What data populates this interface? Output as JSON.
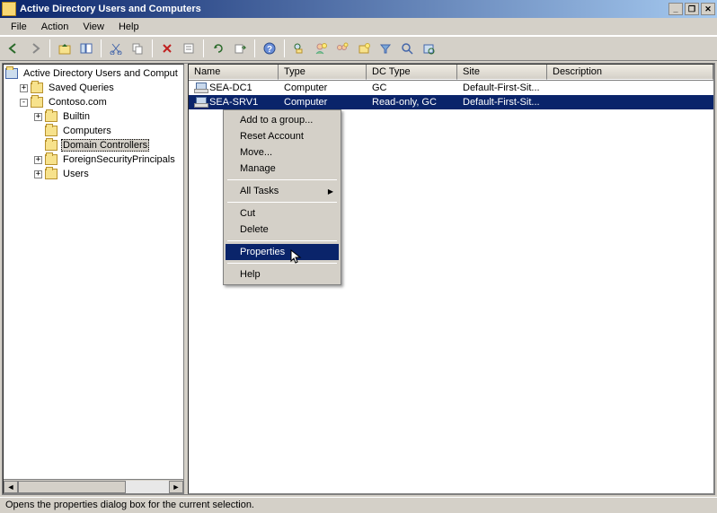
{
  "window": {
    "title": "Active Directory Users and Computers",
    "buttons": {
      "min": "_",
      "max": "❐",
      "close": "✕"
    }
  },
  "menu": {
    "items": [
      "File",
      "Action",
      "View",
      "Help"
    ]
  },
  "tree": {
    "root": "Active Directory Users and Comput",
    "nodes": [
      {
        "label": "Saved Queries",
        "expander": "+",
        "indent": 16
      },
      {
        "label": "Contoso.com",
        "expander": "-",
        "indent": 16
      },
      {
        "label": "Builtin",
        "expander": "+",
        "indent": 32
      },
      {
        "label": "Computers",
        "expander": "",
        "indent": 44
      },
      {
        "label": "Domain Controllers",
        "expander": "",
        "indent": 44,
        "selected": true
      },
      {
        "label": "ForeignSecurityPrincipals",
        "expander": "+",
        "indent": 32
      },
      {
        "label": "Users",
        "expander": "+",
        "indent": 32
      }
    ]
  },
  "list": {
    "headers": [
      "Name",
      "Type",
      "DC Type",
      "Site",
      "Description"
    ],
    "rows": [
      {
        "name": "SEA-DC1",
        "type": "Computer",
        "dcType": "GC",
        "site": "Default-First-Sit...",
        "desc": "",
        "selected": false
      },
      {
        "name": "SEA-SRV1",
        "type": "Computer",
        "dcType": "Read-only, GC",
        "site": "Default-First-Sit...",
        "desc": "",
        "selected": true
      }
    ]
  },
  "contextMenu": {
    "groups": [
      [
        "Add to a group...",
        "Reset Account",
        "Move...",
        "Manage"
      ],
      [
        "All Tasks"
      ],
      [
        "Cut",
        "Delete"
      ],
      [
        "Properties"
      ],
      [
        "Help"
      ]
    ],
    "submenu": "All Tasks",
    "highlighted": "Properties"
  },
  "status": "Opens the properties dialog box for the current selection.",
  "toolbarIcons": [
    "nav-back",
    "nav-forward",
    "up",
    "show-hide",
    "cut",
    "copy",
    "delete",
    "properties",
    "refresh",
    "export",
    "help",
    "find",
    "add-user",
    "add-group",
    "add-ou",
    "filter",
    "search",
    "saved-query"
  ]
}
